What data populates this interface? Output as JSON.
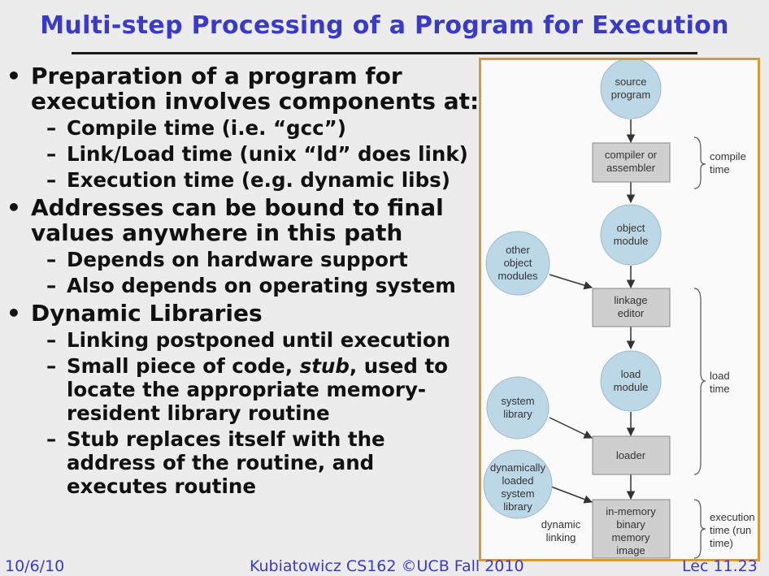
{
  "title": "Multi-step Processing of a Program for Execution",
  "bullets": [
    {
      "text": "Preparation of a program for execution involves components at:",
      "sub": [
        "Compile time (i.e. “gcc”)",
        "Link/Load time (unix “ld” does link)",
        "Execution time (e.g. dynamic libs)"
      ]
    },
    {
      "text": "Addresses can be bound to final values anywhere in this path",
      "sub": [
        "Depends on hardware support",
        "Also depends on operating system"
      ]
    },
    {
      "text": "Dynamic Libraries",
      "sub": [
        "Linking postponed until execution",
        "Small piece of code, stub, used to locate the appropriate memory-resident library routine",
        "Stub replaces itself with the address of the routine, and executes routine"
      ]
    }
  ],
  "bullet_lines": {
    "b1_l1": "Preparation of a program for",
    "b1_l2": "execution involves components at:",
    "b2_l1": "Addresses can be bound to final",
    "b2_l2": "values anywhere in this path",
    "b3_l1": "Dynamic Libraries",
    "s31": "Linking postponed until execution",
    "s32_pre": "Small piece of code, ",
    "s32_em": "stub",
    "s32_post": ", used to",
    "s32_l2": "locate the appropriate memory-",
    "s32_l3": "resident library routine",
    "s33_l1": "Stub replaces itself with the",
    "s33_l2": "address of the routine, and",
    "s33_l3": "executes routine"
  },
  "diagram": {
    "source_program": [
      "source",
      "program"
    ],
    "compiler": [
      "compiler or",
      "assembler"
    ],
    "object_module": [
      "object",
      "module"
    ],
    "other_object_modules": [
      "other",
      "object",
      "modules"
    ],
    "linkage_editor": [
      "linkage",
      "editor"
    ],
    "load_module": [
      "load",
      "module"
    ],
    "system_library": [
      "system",
      "library"
    ],
    "loader": "loader",
    "dyn_loaded_lib": [
      "dynamically",
      "loaded",
      "system",
      "library"
    ],
    "in_memory": [
      "in-memory",
      "binary",
      "memory",
      "image"
    ],
    "dynamic_linking": [
      "dynamic",
      "linking"
    ],
    "compile_time": [
      "compile",
      "time"
    ],
    "load_time": [
      "load",
      "time"
    ],
    "execution_time": [
      "execution",
      "time (run",
      "time)"
    ]
  },
  "footer": {
    "date": "10/6/10",
    "course": "Kubiatowicz CS162 ©UCB Fall 2010",
    "lecture": "Lec 11.23"
  },
  "colors": {
    "title": "#3a3ac8",
    "circle_fill": "#bcd7e6",
    "box_fill": "#cfcfcf",
    "frame": "#d69a3a"
  }
}
